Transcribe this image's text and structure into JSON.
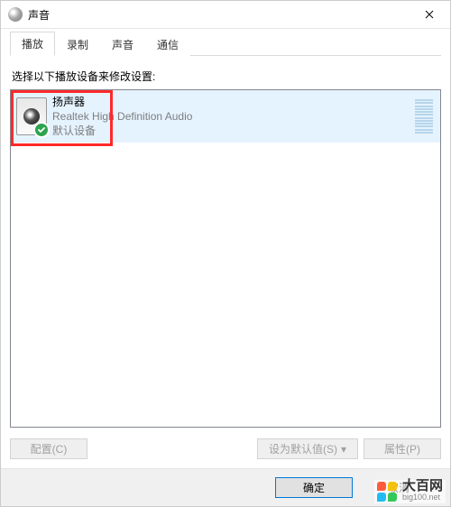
{
  "window": {
    "title": "声音"
  },
  "tabs": [
    {
      "label": "播放",
      "active": true
    },
    {
      "label": "录制",
      "active": false
    },
    {
      "label": "声音",
      "active": false
    },
    {
      "label": "通信",
      "active": false
    }
  ],
  "instruction": "选择以下播放设备来修改设置:",
  "devices": [
    {
      "name": "扬声器",
      "driver": "Realtek High Definition Audio",
      "status": "默认设备",
      "default": true,
      "selected": true
    }
  ],
  "buttons": {
    "configure": "配置(C)",
    "set_default": "设为默认值(S)",
    "properties": "属性(P)",
    "ok": "确定",
    "cancel": "取消"
  },
  "watermark": {
    "brand": "大百网",
    "url": "big100.net"
  }
}
